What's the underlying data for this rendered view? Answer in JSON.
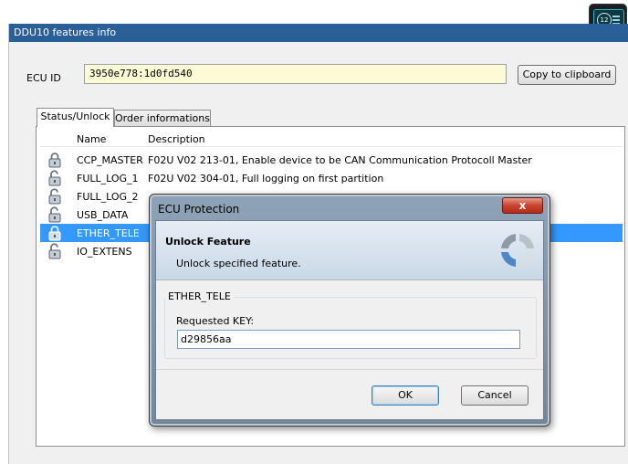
{
  "main_window": {
    "title": "DDU10 features info",
    "ecu_id_label": "ECU ID",
    "ecu_id_value": "3950e778:1d0fd540",
    "copy_button": "Copy to clipboard"
  },
  "device_thumb": {
    "clock": "12"
  },
  "tabs": [
    {
      "label": "Status/Unlock",
      "active": true
    },
    {
      "label": "Order informations",
      "active": false
    }
  ],
  "list": {
    "columns": [
      "Name",
      "Description"
    ],
    "rows": [
      {
        "name": "CCP_MASTER",
        "description": "F02U V02 213-01, Enable device to be CAN Communication Protocoll Master",
        "lock": "locked"
      },
      {
        "name": "FULL_LOG_1",
        "description": "F02U V02 304-01, Full logging on first partition",
        "lock": "unlocked"
      },
      {
        "name": "FULL_LOG_2",
        "description": "",
        "lock": "unlocked"
      },
      {
        "name": "USB_DATA",
        "description": "",
        "lock": "unlocked"
      },
      {
        "name": "ETHER_TELE",
        "description": "",
        "lock": "locked",
        "selected": true
      },
      {
        "name": "IO_EXTENS",
        "description": "",
        "lock": "unlocked"
      }
    ]
  },
  "dialog": {
    "title": "ECU Protection",
    "close_glyph": "x",
    "header_title": "Unlock Feature",
    "header_subtitle": "Unlock specified feature.",
    "group_title": "ETHER_TELE",
    "key_label": "Requested KEY:",
    "key_value": "d29856aa",
    "ok": "OK",
    "cancel": "Cancel"
  },
  "colors": {
    "titlebar": "#2a5f97",
    "selection": "#3399ff",
    "ecu_field_bg": "#fdfbd6",
    "close_button": "#c8432e"
  }
}
